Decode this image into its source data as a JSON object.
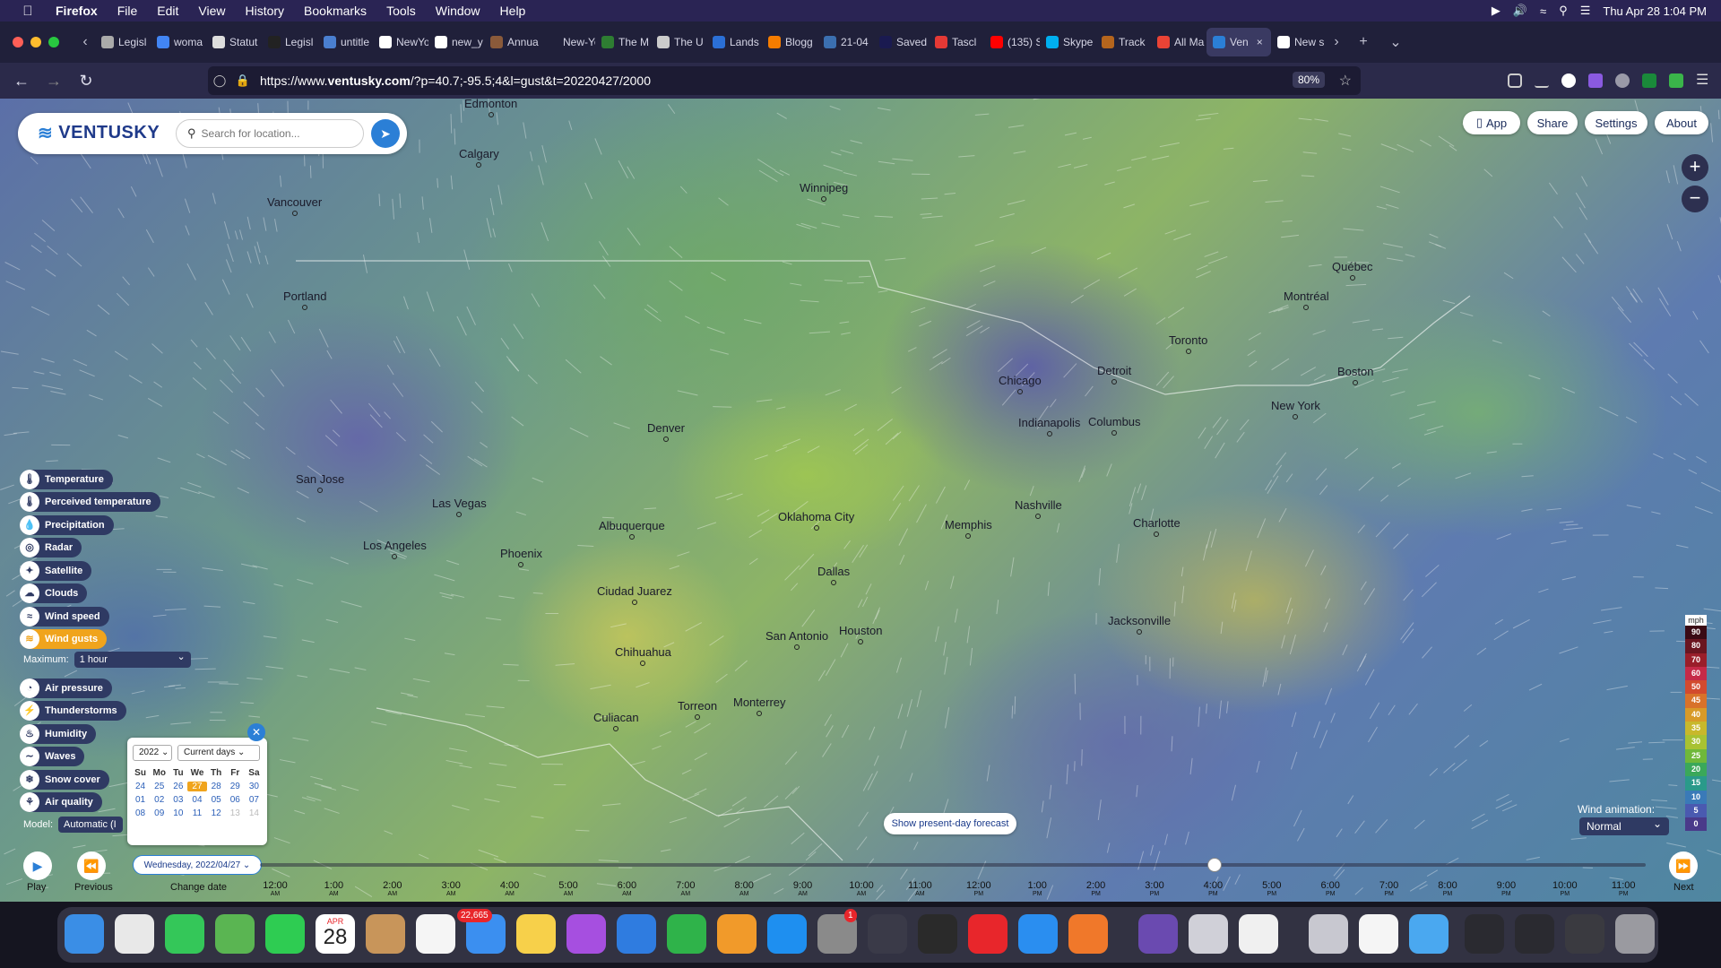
{
  "menubar": {
    "app": "Firefox",
    "items": [
      "File",
      "Edit",
      "View",
      "History",
      "Bookmarks",
      "Tools",
      "Window",
      "Help"
    ],
    "clock": "Thu Apr 28  1:04 PM"
  },
  "tabs": [
    {
      "label": "Legisl",
      "color": "#aaa"
    },
    {
      "label": "woma",
      "color": "#4285f4"
    },
    {
      "label": "Statut",
      "color": "#ddd"
    },
    {
      "label": "Legisl",
      "color": "#222"
    },
    {
      "label": "untitle",
      "color": "#4a7fd0"
    },
    {
      "label": "NewYo",
      "color": "#fff"
    },
    {
      "label": "new_y",
      "color": "#fff"
    },
    {
      "label": "Annua",
      "color": "#8a5a3a"
    },
    {
      "label": "New-York_",
      "color": "#20203a"
    },
    {
      "label": "The M",
      "color": "#2e7d32"
    },
    {
      "label": "The U",
      "color": "#ccc"
    },
    {
      "label": "Lands",
      "color": "#2b6fd6"
    },
    {
      "label": "Blogg",
      "color": "#f57c00"
    },
    {
      "label": "21-04",
      "color": "#3b6fb0"
    },
    {
      "label": "Saved",
      "color": "#1a1a50"
    },
    {
      "label": "Tascl",
      "color": "#e53935"
    },
    {
      "label": "(135) S",
      "color": "#ff0000"
    },
    {
      "label": "Skype",
      "color": "#00aff0"
    },
    {
      "label": "Track",
      "color": "#b5651d"
    },
    {
      "label": "All Ma",
      "color": "#ea4335"
    },
    {
      "label": "Ven",
      "color": "#2b7fd6",
      "active": true
    },
    {
      "label": "New s",
      "color": "#fff"
    }
  ],
  "navbar": {
    "url_prefix": "https://www.",
    "url_domain": "ventusky.com",
    "url_rest": "/?p=40.7;-95.5;4&l=gust&t=20220427/2000",
    "zoom": "80%"
  },
  "app": {
    "logo": "VENTUSKY",
    "search_placeholder": "Search for location...",
    "top_buttons": [
      "App",
      "Share",
      "Settings",
      "About"
    ]
  },
  "cities": [
    {
      "name": "Edmonton"
    },
    {
      "name": "Calgary"
    },
    {
      "name": "Winnipeg"
    },
    {
      "name": "Vancouver"
    },
    {
      "name": "Portland"
    },
    {
      "name": "Québec"
    },
    {
      "name": "Montréal"
    },
    {
      "name": "Toronto"
    },
    {
      "name": "Boston"
    },
    {
      "name": "Detroit"
    },
    {
      "name": "Chicago"
    },
    {
      "name": "New York"
    },
    {
      "name": "Denver"
    },
    {
      "name": "Indianapolis"
    },
    {
      "name": "Columbus"
    },
    {
      "name": "San Jose"
    },
    {
      "name": "Las Vegas"
    },
    {
      "name": "Nashville"
    },
    {
      "name": "Albuquerque"
    },
    {
      "name": "Oklahoma City"
    },
    {
      "name": "Memphis"
    },
    {
      "name": "Charlotte"
    },
    {
      "name": "Los Angeles"
    },
    {
      "name": "Phoenix"
    },
    {
      "name": "Dallas"
    },
    {
      "name": "Ciudad Juarez"
    },
    {
      "name": "Houston"
    },
    {
      "name": "Jacksonville"
    },
    {
      "name": "San Antonio"
    },
    {
      "name": "Chihuahua"
    },
    {
      "name": "Torreon"
    },
    {
      "name": "Monterrey"
    },
    {
      "name": "Culiacan"
    }
  ],
  "layers": [
    {
      "label": "Temperature",
      "icon": "thermometer-icon"
    },
    {
      "label": "Perceived temperature",
      "icon": "thermometer-icon"
    },
    {
      "label": "Precipitation",
      "icon": "drop-icon"
    },
    {
      "label": "Radar",
      "icon": "radar-icon"
    },
    {
      "label": "Satellite",
      "icon": "satellite-icon"
    },
    {
      "label": "Clouds",
      "icon": "cloud-icon"
    },
    {
      "label": "Wind speed",
      "icon": "wind-icon"
    },
    {
      "label": "Wind gusts",
      "icon": "wind-gust-icon",
      "active": true
    },
    {
      "label": "Air pressure",
      "icon": "gauge-icon"
    },
    {
      "label": "Thunderstorms",
      "icon": "lightning-icon"
    },
    {
      "label": "Humidity",
      "icon": "humidity-icon"
    },
    {
      "label": "Waves",
      "icon": "wave-icon"
    },
    {
      "label": "Snow cover",
      "icon": "snowflake-icon"
    },
    {
      "label": "Air quality",
      "icon": "air-quality-icon"
    }
  ],
  "maximum": {
    "label": "Maximum:",
    "value": "1 hour"
  },
  "model": {
    "label": "Model:",
    "value": "Automatic (I"
  },
  "calendar": {
    "year": "2022",
    "mode": "Current days",
    "weekdays": [
      "Su",
      "Mo",
      "Tu",
      "We",
      "Th",
      "Fr",
      "Sa"
    ],
    "days": [
      {
        "d": "24"
      },
      {
        "d": "25"
      },
      {
        "d": "26"
      },
      {
        "d": "27",
        "today": true
      },
      {
        "d": "28"
      },
      {
        "d": "29"
      },
      {
        "d": "30"
      },
      {
        "d": "01"
      },
      {
        "d": "02"
      },
      {
        "d": "03"
      },
      {
        "d": "04"
      },
      {
        "d": "05"
      },
      {
        "d": "06"
      },
      {
        "d": "07"
      },
      {
        "d": "08"
      },
      {
        "d": "09"
      },
      {
        "d": "10"
      },
      {
        "d": "11"
      },
      {
        "d": "12"
      },
      {
        "d": "13",
        "muted": true
      },
      {
        "d": "14",
        "muted": true
      }
    ]
  },
  "legend": {
    "unit": "mph",
    "levels": [
      {
        "v": "90",
        "c": "#3a0a14"
      },
      {
        "v": "80",
        "c": "#6a1520"
      },
      {
        "v": "70",
        "c": "#9a1e2a"
      },
      {
        "v": "60",
        "c": "#c52a48"
      },
      {
        "v": "50",
        "c": "#d24a2e"
      },
      {
        "v": "45",
        "c": "#d8722a"
      },
      {
        "v": "40",
        "c": "#d89a28"
      },
      {
        "v": "35",
        "c": "#c8b82c"
      },
      {
        "v": "30",
        "c": "#a8c232"
      },
      {
        "v": "25",
        "c": "#6fb83a"
      },
      {
        "v": "20",
        "c": "#3aa85a"
      },
      {
        "v": "15",
        "c": "#2a9a8a"
      },
      {
        "v": "10",
        "c": "#3a7ab8"
      },
      {
        "v": "5",
        "c": "#4a5ab0"
      },
      {
        "v": "0",
        "c": "#4a3a8a"
      }
    ]
  },
  "wind_animation": {
    "label": "Wind animation:",
    "value": "Normal"
  },
  "present_forecast": "Show present-day forecast",
  "timeline": {
    "play": "Play",
    "previous": "Previous",
    "next": "Next",
    "change_date": "Change date",
    "date": "Wednesday, 2022/04/27",
    "hours": [
      {
        "t": "12:00",
        "p": "AM"
      },
      {
        "t": "1:00",
        "p": "AM"
      },
      {
        "t": "2:00",
        "p": "AM"
      },
      {
        "t": "3:00",
        "p": "AM"
      },
      {
        "t": "4:00",
        "p": "AM"
      },
      {
        "t": "5:00",
        "p": "AM"
      },
      {
        "t": "6:00",
        "p": "AM"
      },
      {
        "t": "7:00",
        "p": "AM"
      },
      {
        "t": "8:00",
        "p": "AM"
      },
      {
        "t": "9:00",
        "p": "AM"
      },
      {
        "t": "10:00",
        "p": "AM"
      },
      {
        "t": "11:00",
        "p": "AM"
      },
      {
        "t": "12:00",
        "p": "PM"
      },
      {
        "t": "1:00",
        "p": "PM"
      },
      {
        "t": "2:00",
        "p": "PM"
      },
      {
        "t": "3:00",
        "p": "PM"
      },
      {
        "t": "4:00",
        "p": "PM"
      },
      {
        "t": "5:00",
        "p": "PM"
      },
      {
        "t": "6:00",
        "p": "PM"
      },
      {
        "t": "7:00",
        "p": "PM"
      },
      {
        "t": "8:00",
        "p": "PM"
      },
      {
        "t": "9:00",
        "p": "PM"
      },
      {
        "t": "10:00",
        "p": "PM"
      },
      {
        "t": "11:00",
        "p": "PM"
      }
    ]
  },
  "dock": {
    "calendar_month": "APR",
    "calendar_day": "28",
    "mail_badge": "22,665",
    "settings_badge": "1",
    "icons": [
      {
        "name": "finder-icon",
        "c": "#3a8ee6"
      },
      {
        "name": "launchpad-icon",
        "c": "#e8e8e8"
      },
      {
        "name": "messages-icon",
        "c": "#34c759"
      },
      {
        "name": "maps-icon",
        "c": "#5ab552"
      },
      {
        "name": "facetime-icon",
        "c": "#2ecc52"
      },
      {
        "name": "calendar-icon",
        "c": "#ffffff"
      },
      {
        "name": "contacts-icon",
        "c": "#c8955a"
      },
      {
        "name": "reminders-icon",
        "c": "#f5f5f5"
      },
      {
        "name": "mail-icon",
        "c": "#3b8ff0"
      },
      {
        "name": "notes-icon",
        "c": "#f7d04a"
      },
      {
        "name": "podcasts-icon",
        "c": "#a64fe0"
      },
      {
        "name": "keynote-icon",
        "c": "#2f7ce0"
      },
      {
        "name": "numbers-icon",
        "c": "#2fb34a"
      },
      {
        "name": "pages-icon",
        "c": "#f19a2a"
      },
      {
        "name": "app-store-icon",
        "c": "#1e8ff0"
      },
      {
        "name": "system-preferences-icon",
        "c": "#8a8a8a"
      },
      {
        "name": "quicktime-icon",
        "c": "#3a3a48"
      },
      {
        "name": "screenshot-icon",
        "c": "#2a2a2a"
      },
      {
        "name": "opera-icon",
        "c": "#e8262b"
      },
      {
        "name": "safari-icon",
        "c": "#2a8ef0"
      },
      {
        "name": "firefox-icon",
        "c": "#f0782a"
      },
      {
        "name": "imovie-icon",
        "c": "#6a4ab0"
      },
      {
        "name": "preview-icon",
        "c": "#d0d0d8"
      },
      {
        "name": "textedit-icon",
        "c": "#f0f0f0"
      },
      {
        "name": "downloads-stack-icon",
        "c": "#c8c8d0"
      },
      {
        "name": "document-icon",
        "c": "#f5f5f5"
      },
      {
        "name": "folder-icon",
        "c": "#4aa8f0"
      },
      {
        "name": "keyboard-viewer-icon",
        "c": "#2a2a30"
      },
      {
        "name": "keyboard-viewer-icon-2",
        "c": "#2a2a30"
      },
      {
        "name": "calculator-stack-icon",
        "c": "#3a3a40"
      },
      {
        "name": "trash-icon",
        "c": "#9a9aa0"
      }
    ]
  }
}
